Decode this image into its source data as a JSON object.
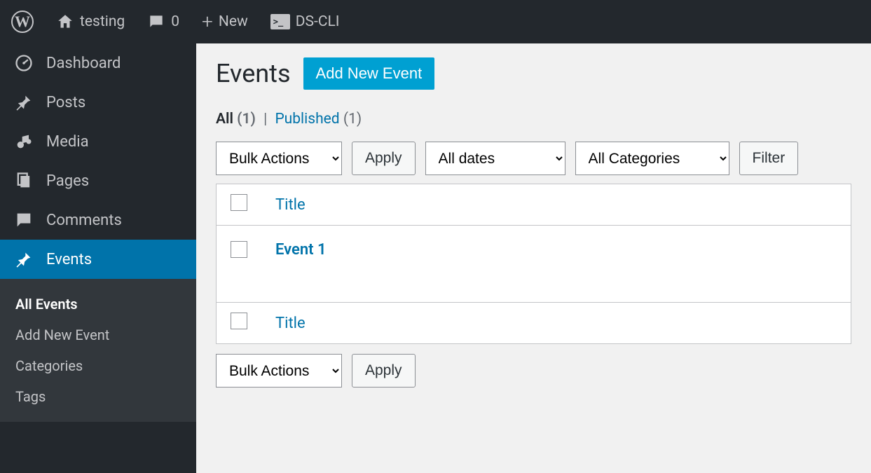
{
  "adminbar": {
    "site_name": "testing",
    "comments_count": "0",
    "new_label": "New",
    "dscli_label": "DS-CLI"
  },
  "sidebar": {
    "items": [
      {
        "label": "Dashboard",
        "icon": "dashboard"
      },
      {
        "label": "Posts",
        "icon": "pin"
      },
      {
        "label": "Media",
        "icon": "media"
      },
      {
        "label": "Pages",
        "icon": "pages"
      },
      {
        "label": "Comments",
        "icon": "comment"
      },
      {
        "label": "Events",
        "icon": "pin",
        "active": true
      }
    ],
    "submenu": [
      {
        "label": "All Events",
        "current": true
      },
      {
        "label": "Add New Event"
      },
      {
        "label": "Categories"
      },
      {
        "label": "Tags"
      }
    ]
  },
  "page": {
    "title": "Events",
    "add_new_label": "Add New Event"
  },
  "filters": {
    "status_links": {
      "all_label": "All",
      "all_count": "(1)",
      "published_label": "Published",
      "published_count": "(1)"
    },
    "bulk_actions_label": "Bulk Actions",
    "apply_label": "Apply",
    "date_filter_label": "All dates",
    "category_filter_label": "All Categories",
    "filter_label": "Filter"
  },
  "table": {
    "column_title": "Title",
    "rows": [
      {
        "title": "Event 1"
      }
    ]
  },
  "bottom": {
    "bulk_actions_label": "Bulk Actions",
    "apply_label": "Apply"
  }
}
